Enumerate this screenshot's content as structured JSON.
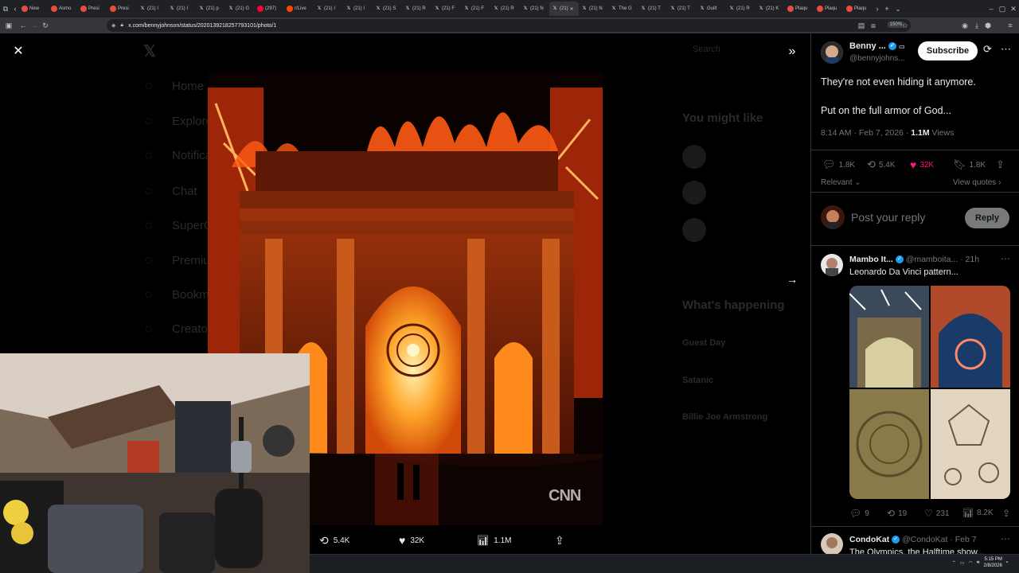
{
  "browser": {
    "tabs": [
      {
        "label": "New",
        "color": "#e74c3c"
      },
      {
        "label": "Asmo",
        "color": "#e74c3c"
      },
      {
        "label": "Presi",
        "color": "#e74c3c"
      },
      {
        "label": "Presi",
        "color": "#e74c3c"
      },
      {
        "label": "(21) I",
        "color": "#ffffff"
      },
      {
        "label": "(21) I",
        "color": "#ffffff"
      },
      {
        "label": "(21) p",
        "color": "#ffffff"
      },
      {
        "label": "(21) G",
        "color": "#ffffff"
      },
      {
        "label": "(297)",
        "color": "#ff0033"
      },
      {
        "label": "r/Live",
        "color": "#ff4500"
      },
      {
        "label": "(21) I",
        "color": "#ffffff"
      },
      {
        "label": "(21) I",
        "color": "#ffffff"
      },
      {
        "label": "(21) S",
        "color": "#ffffff"
      },
      {
        "label": "(21) R",
        "color": "#ffffff"
      },
      {
        "label": "(21) F",
        "color": "#ffffff"
      },
      {
        "label": "(21) F",
        "color": "#ffffff"
      },
      {
        "label": "(21) R",
        "color": "#ffffff"
      },
      {
        "label": "(21) N",
        "color": "#ffffff"
      },
      {
        "label": "(21)",
        "color": "#ffffff"
      },
      {
        "label": "(21) N",
        "color": "#ffffff"
      },
      {
        "label": "The G",
        "color": "#ffffff"
      },
      {
        "label": "(21) T",
        "color": "#ffffff"
      },
      {
        "label": "(21) T",
        "color": "#ffffff"
      },
      {
        "label": "Guilt",
        "color": "#ffffff"
      },
      {
        "label": "(21) R",
        "color": "#ffffff"
      },
      {
        "label": "(21) K",
        "color": "#ffffff"
      },
      {
        "label": "Plaqu",
        "color": "#e74c3c"
      },
      {
        "label": "Plaqu",
        "color": "#e74c3c"
      },
      {
        "label": "Plaqu",
        "color": "#e74c3c"
      }
    ],
    "active_tab_index": 18,
    "url": "x.com/bennyjohnson/status/2020139218257793101/photo/1",
    "zoom": "150%"
  },
  "background_nav": [
    "Home",
    "Explore",
    "Notifications",
    "Chat",
    "SuperGrok",
    "Premium",
    "Bookmarks",
    "Creator Studio"
  ],
  "background_right": {
    "search": "Search",
    "you_might_like": "You might like",
    "whats_happening": "What's happening",
    "items": [
      "Guest Day",
      "Satanic",
      "Billie Joe Armstrong"
    ]
  },
  "media_actions": {
    "retweets": "5.4K",
    "likes": "32K",
    "views": "1.1M"
  },
  "watermark": "CNN",
  "tweet": {
    "author_name": "Benny ...",
    "author_handle": "@bennyjohns...",
    "subscribe_label": "Subscribe",
    "text_line1": "They're not even hiding it anymore.",
    "text_line2": "Put on the full armor of God...",
    "timestamp": "8:14 AM · Feb 7, 2026 · ",
    "views_count": "1.1M",
    "views_label": " Views",
    "replies": "1.8K",
    "retweets": "5.4K",
    "likes": "32K",
    "bookmarks": "1.8K",
    "sort_label": "Relevant",
    "view_quotes_label": "View quotes",
    "reply_placeholder": "Post your reply",
    "reply_button": "Reply",
    "like_color": "#f91880"
  },
  "replies": [
    {
      "name": "Mambo It...",
      "handle": "@mamboita...",
      "time": "21h",
      "text": "Leonardo Da Vinci pattern...",
      "replies": "9",
      "retweets": "19",
      "likes": "231",
      "views": "8.2K"
    },
    {
      "name": "CondoKat",
      "handle": "@CondoKat",
      "time": "Feb 7",
      "text": "The Olympics, the Halftime show..."
    }
  ],
  "taskbar": {
    "time": "5:15 PM",
    "date": "2/8/2026"
  }
}
